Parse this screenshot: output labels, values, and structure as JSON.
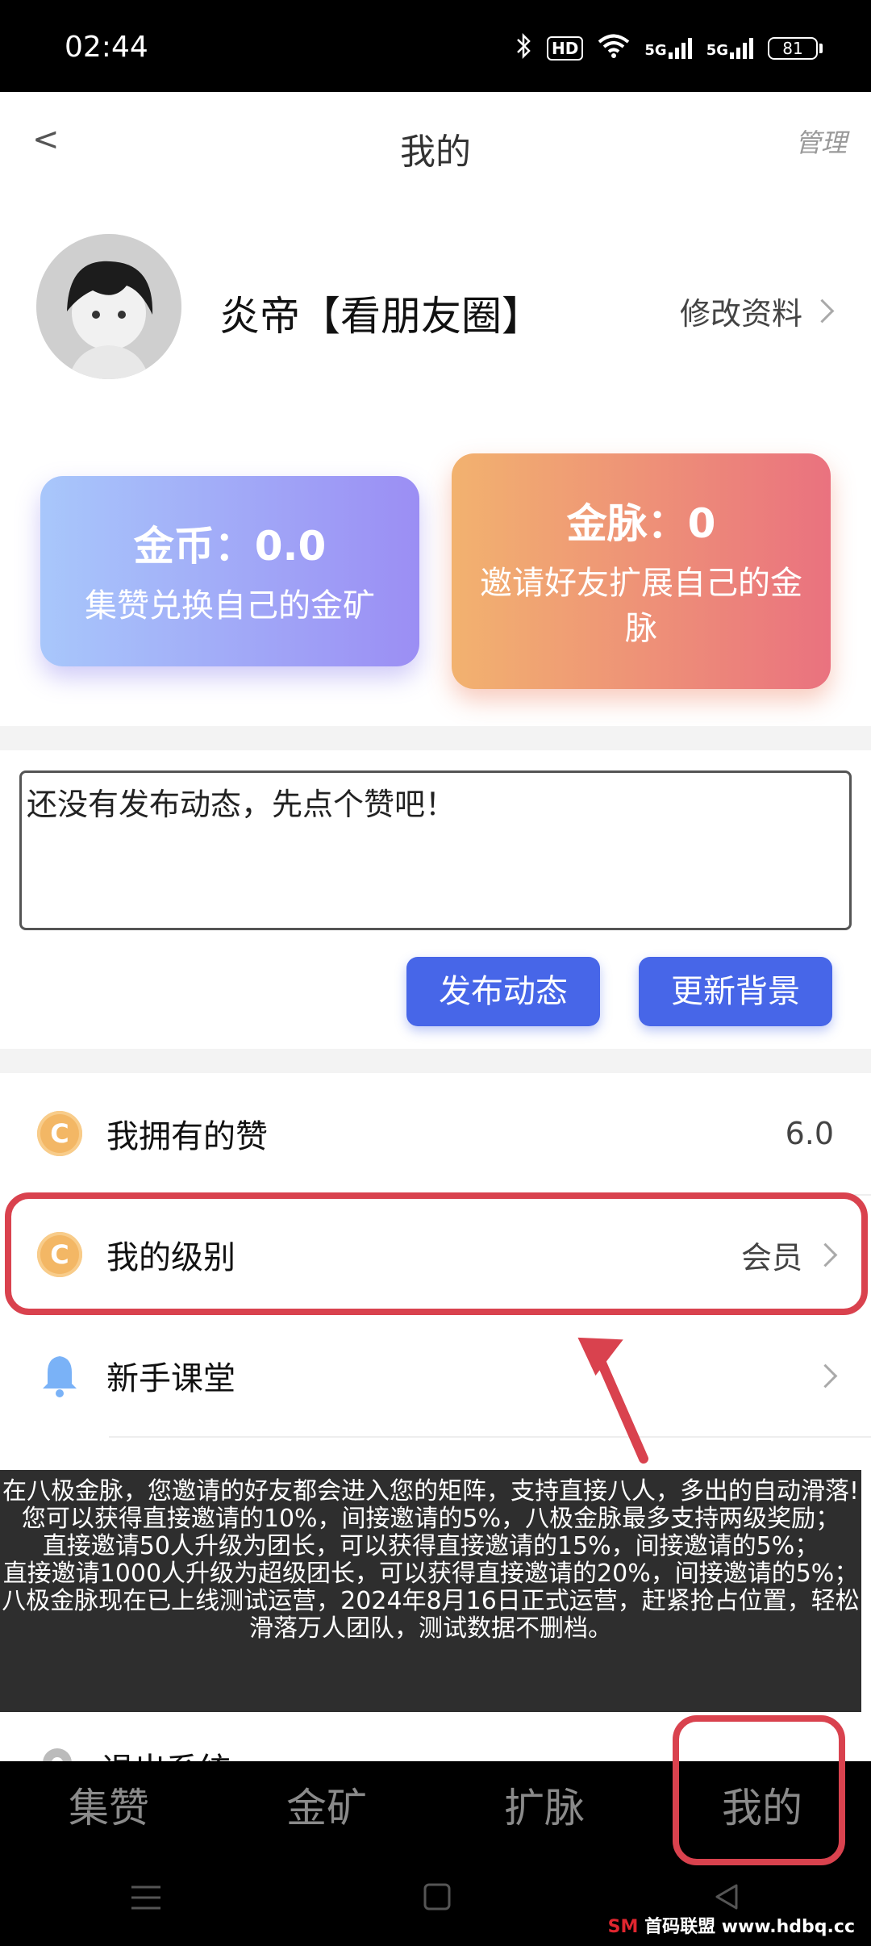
{
  "status_bar": {
    "time": "02:44",
    "hd_badge": "HD",
    "net_1": "5G",
    "net_2": "5G",
    "battery": "81"
  },
  "header": {
    "title": "我的",
    "back": "<",
    "manage": "管理"
  },
  "profile": {
    "username": "炎帝【看朋友圈】",
    "edit": "修改资料"
  },
  "cards": {
    "coins": {
      "title": "金币：0.0",
      "subtitle": "集赞兑换自己的金矿"
    },
    "veins": {
      "title": "金脉：0",
      "subtitle": "邀请好友扩展自己的金脉"
    }
  },
  "post": {
    "text": "还没有发布动态，先点个赞吧！",
    "publish": "发布动态",
    "update_bg": "更新背景"
  },
  "list": {
    "likes": {
      "label": "我拥有的赞",
      "value": "6.0",
      "icon": "coin-c-icon"
    },
    "level": {
      "label": "我的级别",
      "value": "会员",
      "icon": "coin-c-icon"
    },
    "course": {
      "label": "新手课堂",
      "icon": "bell-icon"
    },
    "logout": {
      "label": "退出系统",
      "icon": "gear-icon"
    }
  },
  "tooltip": {
    "lines": [
      "在八极金脉，您邀请的好友都会进入您的矩阵，支持直接八人，多出的自动滑落!您可以获得直接邀请的10%，间接邀请的5%，八极金脉最多支持两级奖励；",
      "直接邀请50人升级为团长，可以获得直接邀请的15%，间接邀请的5%；",
      "直接邀请1000人升级为超级团长，可以获得直接邀请的20%，间接邀请的5%；",
      "八极金脉现在已上线测试运营，2024年8月16日正式运营，赶紧抢占位置，轻松滑落万人团队，测试数据不删档。"
    ]
  },
  "bottom_nav": {
    "items": [
      "集赞",
      "金矿",
      "扩脉",
      "我的"
    ]
  },
  "watermark": {
    "sm": "SM",
    "text": "首码联盟 www.hdbq.cc"
  },
  "colors": {
    "accent": "#4766e8",
    "highlight": "#d9424e",
    "coin": "#f3b765"
  }
}
